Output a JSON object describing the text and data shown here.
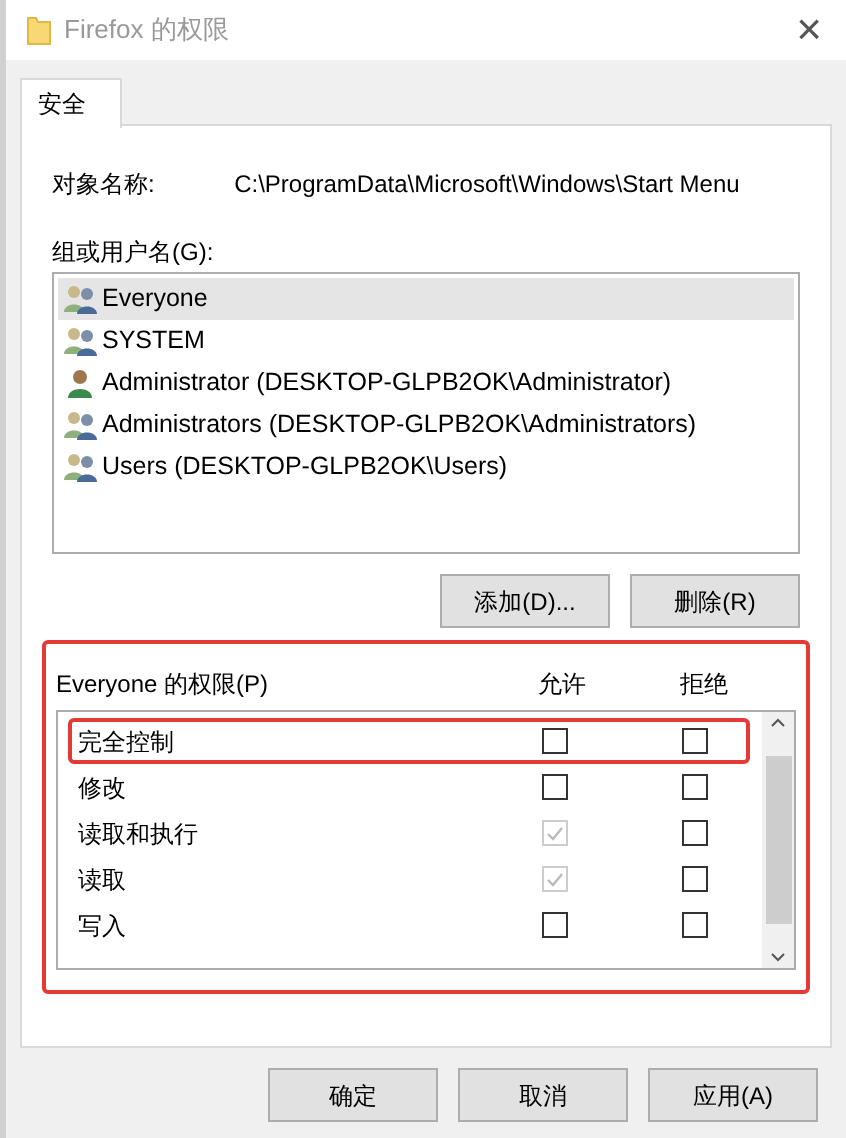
{
  "window": {
    "title": "Firefox 的权限",
    "close": "×"
  },
  "tabs": [
    {
      "label": "安全",
      "selected": true
    }
  ],
  "object_name": {
    "label": "对象名称:",
    "value": "C:\\ProgramData\\Microsoft\\Windows\\Start Menu"
  },
  "users": {
    "label": "组或用户名(G):",
    "items": [
      {
        "name": "Everyone",
        "kind": "group",
        "selected": true
      },
      {
        "name": "SYSTEM",
        "kind": "group",
        "selected": false
      },
      {
        "name": "Administrator (DESKTOP-GLPB2OK\\Administrator)",
        "kind": "user",
        "selected": false
      },
      {
        "name": "Administrators (DESKTOP-GLPB2OK\\Administrators)",
        "kind": "group",
        "selected": false
      },
      {
        "name": "Users (DESKTOP-GLPB2OK\\Users)",
        "kind": "group",
        "selected": false
      }
    ]
  },
  "user_buttons": [
    "添加(D)...",
    "删除(R)"
  ],
  "permissions": {
    "highlighted": true,
    "label": "Everyone 的权限(P)",
    "allow_header": "允许",
    "deny_header": "拒绝",
    "rows": [
      {
        "name": "完全控制",
        "highlighted": true,
        "allow": {
          "checked": false,
          "disabled": false
        },
        "deny": {
          "checked": false,
          "disabled": false
        }
      },
      {
        "name": "修改",
        "highlighted": false,
        "allow": {
          "checked": false,
          "disabled": false
        },
        "deny": {
          "checked": false,
          "disabled": false
        }
      },
      {
        "name": "读取和执行",
        "highlighted": false,
        "allow": {
          "checked": true,
          "disabled": true
        },
        "deny": {
          "checked": false,
          "disabled": false
        }
      },
      {
        "name": "读取",
        "highlighted": false,
        "allow": {
          "checked": true,
          "disabled": true
        },
        "deny": {
          "checked": false,
          "disabled": false
        }
      },
      {
        "name": "写入",
        "highlighted": false,
        "allow": {
          "checked": false,
          "disabled": false
        },
        "deny": {
          "checked": false,
          "disabled": false
        }
      }
    ]
  },
  "buttons": [
    "确定",
    "取消",
    "应用(A)"
  ]
}
